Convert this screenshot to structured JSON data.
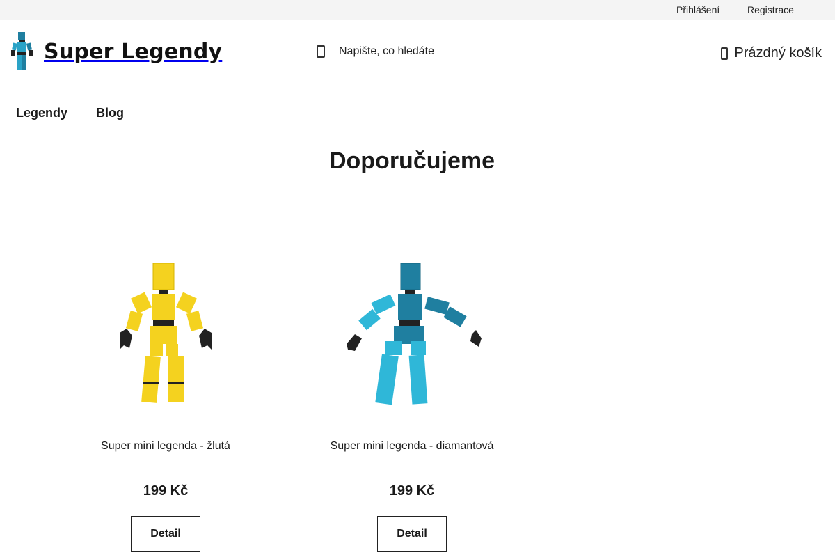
{
  "topbar": {
    "login": "Přihlášení",
    "register": "Registrace"
  },
  "header": {
    "logo_text": "Super Legendy",
    "search_placeholder": "Napište, co hledáte",
    "search_icon": "search-icon",
    "cart_label": "Prázdný košík",
    "cart_icon": "cart-icon"
  },
  "nav": {
    "items": [
      {
        "label": "Legendy"
      },
      {
        "label": "Blog"
      }
    ]
  },
  "main": {
    "title": "Doporučujeme",
    "products": [
      {
        "name": "Super mini legenda - žlutá",
        "price": "199 Kč",
        "button": "Detail",
        "color": "#f4d21f"
      },
      {
        "name": "Super mini legenda - diamantová",
        "price": "199 Kč",
        "button": "Detail",
        "color": "#1fa3c9"
      }
    ]
  }
}
